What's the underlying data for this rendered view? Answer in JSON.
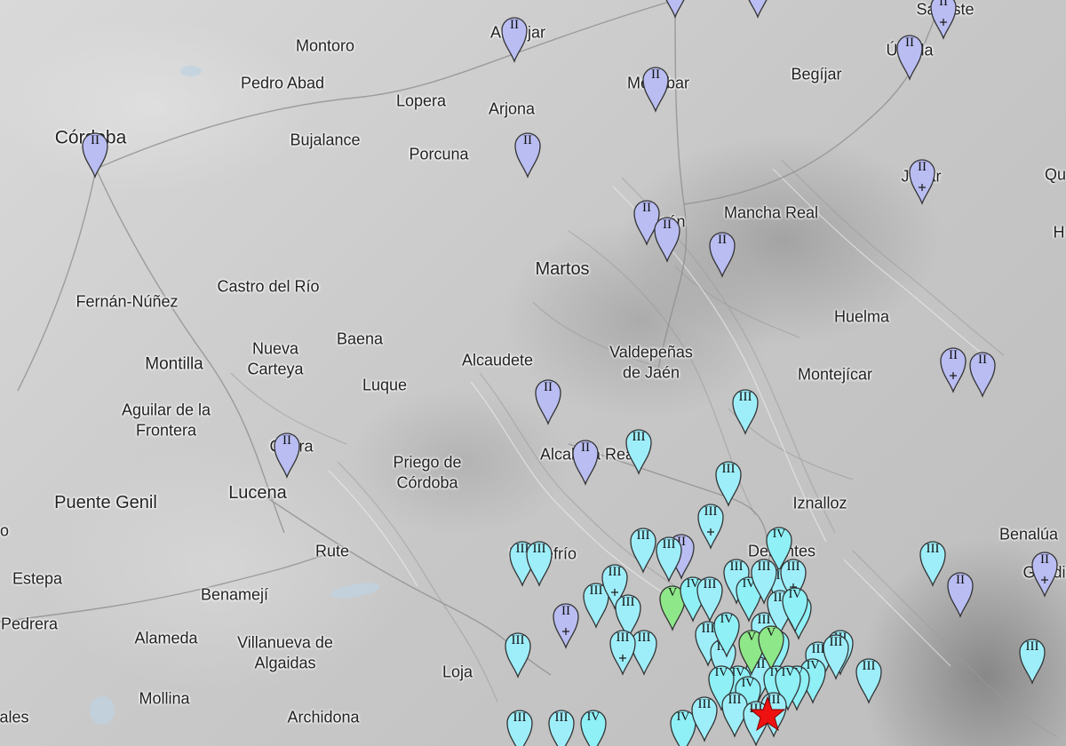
{
  "colors": {
    "intensity_II": "#b9bdf2",
    "intensity_III": "#9eeefa",
    "intensity_IV": "#8ff0f6",
    "intensity_V": "#8ee889",
    "epicenter": "#ee1111",
    "marker_stroke": "#333333",
    "label_text": "#222222"
  },
  "icons": {
    "marker": "map-pin-icon",
    "epicenter": "star-icon"
  },
  "places": [
    {
      "id": "cordoba",
      "name": "Córdoba"
    },
    {
      "id": "montoro",
      "name": "Montoro"
    },
    {
      "id": "pedro-abad",
      "name": "Pedro Abad"
    },
    {
      "id": "bujalance",
      "name": "Bujalance"
    },
    {
      "id": "lopera",
      "name": "Lopera"
    },
    {
      "id": "arjona",
      "name": "Arjona"
    },
    {
      "id": "porcuna",
      "name": "Porcuna"
    },
    {
      "id": "andujar",
      "name": "Andújar"
    },
    {
      "id": "mengibar",
      "name": "Menjíbar"
    },
    {
      "id": "begijar",
      "name": "Begíjar"
    },
    {
      "id": "ubeda",
      "name": "Úbeda"
    },
    {
      "id": "santiste",
      "name": "Santiste"
    },
    {
      "id": "jodar",
      "name": "Jódar"
    },
    {
      "id": "qu",
      "name": "Qu"
    },
    {
      "id": "h",
      "name": "H"
    },
    {
      "id": "jaen",
      "name": "Jaén"
    },
    {
      "id": "mancha-real",
      "name": "Mancha Real"
    },
    {
      "id": "martos",
      "name": "Martos"
    },
    {
      "id": "fernan-nunez",
      "name": "Fernán-Núñez"
    },
    {
      "id": "castro-del-rio",
      "name": "Castro del Río"
    },
    {
      "id": "huelma",
      "name": "Huelma"
    },
    {
      "id": "montilla",
      "name": "Montilla"
    },
    {
      "id": "nueva-carteya",
      "name": "Nueva\nCarteya"
    },
    {
      "id": "baena",
      "name": "Baena"
    },
    {
      "id": "alcaudete",
      "name": "Alcaudete"
    },
    {
      "id": "valdepenas",
      "name": "Valdepeñas\nde Jaén"
    },
    {
      "id": "montejicar",
      "name": "Montejícar"
    },
    {
      "id": "luque",
      "name": "Luque"
    },
    {
      "id": "aguilar",
      "name": "Aguilar de la\nFrontera"
    },
    {
      "id": "cabra",
      "name": "Cabra"
    },
    {
      "id": "priego",
      "name": "Priego de\nCórdoba"
    },
    {
      "id": "alcala-real",
      "name": "Alcalá la Real"
    },
    {
      "id": "lucena",
      "name": "Lucena"
    },
    {
      "id": "puente-genil",
      "name": "Puente Genil"
    },
    {
      "id": "iznalloz",
      "name": "Iznalloz"
    },
    {
      "id": "benalua",
      "name": "Benalúa"
    },
    {
      "id": "guadix",
      "name": "Guadix"
    },
    {
      "id": "o",
      "name": "o"
    },
    {
      "id": "rute",
      "name": "Rute"
    },
    {
      "id": "montefrio",
      "name": "Montefrío"
    },
    {
      "id": "deifontes",
      "name": "Deifontes"
    },
    {
      "id": "estepa",
      "name": "Estepa"
    },
    {
      "id": "benameji",
      "name": "Benamejí"
    },
    {
      "id": "pedrera",
      "name": "Pedrera"
    },
    {
      "id": "alameda",
      "name": "Alameda"
    },
    {
      "id": "villanueva",
      "name": "Villanueva de\nAlgaidas"
    },
    {
      "id": "loja",
      "name": "Loja"
    },
    {
      "id": "mollina",
      "name": "Mollina"
    },
    {
      "id": "archidona",
      "name": "Archidona"
    },
    {
      "id": "sales",
      "name": "ales"
    }
  ],
  "markers": [
    {
      "label": "II",
      "level": "II",
      "plus": false
    },
    {
      "label": "II",
      "level": "II",
      "plus": false
    },
    {
      "label": "II",
      "level": "II",
      "plus": false
    },
    {
      "label": "II",
      "level": "II",
      "plus": true
    },
    {
      "label": "II",
      "level": "II",
      "plus": false
    },
    {
      "label": "II",
      "level": "II",
      "plus": false
    },
    {
      "label": "II",
      "level": "II",
      "plus": false
    },
    {
      "label": "II",
      "level": "II",
      "plus": false
    },
    {
      "label": "II",
      "level": "II",
      "plus": false
    },
    {
      "label": "II",
      "level": "II",
      "plus": false
    },
    {
      "label": "II",
      "level": "II",
      "plus": true
    },
    {
      "label": "II",
      "level": "II",
      "plus": false
    },
    {
      "label": "II",
      "level": "II",
      "plus": true
    },
    {
      "label": "II",
      "level": "II",
      "plus": false
    },
    {
      "label": "II",
      "level": "II",
      "plus": false
    },
    {
      "label": "II",
      "level": "II",
      "plus": false
    },
    {
      "label": "III",
      "level": "III",
      "plus": false
    },
    {
      "label": "II",
      "level": "II",
      "plus": false
    },
    {
      "label": "III",
      "level": "III",
      "plus": false
    },
    {
      "label": "III",
      "level": "III",
      "plus": false
    },
    {
      "label": "III",
      "level": "III",
      "plus": true
    },
    {
      "label": "IV",
      "level": "IV",
      "plus": false
    },
    {
      "label": "III",
      "level": "III",
      "plus": false
    },
    {
      "label": "II",
      "level": "II",
      "plus": false
    },
    {
      "label": "II",
      "level": "II",
      "plus": true
    },
    {
      "label": "III",
      "level": "III",
      "plus": false
    },
    {
      "label": "III",
      "level": "III",
      "plus": false
    },
    {
      "label": "III",
      "level": "III",
      "plus": false
    },
    {
      "label": "III",
      "level": "III",
      "plus": false
    },
    {
      "label": "III",
      "level": "III",
      "plus": false
    },
    {
      "label": "II",
      "level": "II",
      "plus": false
    },
    {
      "label": "III",
      "level": "III",
      "plus": false
    },
    {
      "label": "III",
      "level": "III",
      "plus": false
    },
    {
      "label": "III",
      "level": "III",
      "plus": true
    },
    {
      "label": "II",
      "level": "II",
      "plus": true
    },
    {
      "label": "III",
      "level": "III",
      "plus": false
    },
    {
      "label": "III",
      "level": "III",
      "plus": false
    },
    {
      "label": "III",
      "level": "III",
      "plus": true
    },
    {
      "label": "V",
      "level": "V",
      "plus": false
    },
    {
      "label": "IV",
      "level": "IV",
      "plus": false
    },
    {
      "label": "III",
      "level": "III",
      "plus": false
    },
    {
      "label": "III",
      "level": "III",
      "plus": false
    },
    {
      "label": "III",
      "level": "III",
      "plus": false
    },
    {
      "label": "III",
      "level": "III",
      "plus": false
    },
    {
      "label": "IV",
      "level": "IV",
      "plus": false
    },
    {
      "label": "IV",
      "level": "IV",
      "plus": false
    },
    {
      "label": "III",
      "level": "III",
      "plus": false
    },
    {
      "label": "III",
      "level": "III",
      "plus": true
    },
    {
      "label": "III",
      "level": "III",
      "plus": false
    },
    {
      "label": "III",
      "level": "III",
      "plus": true
    },
    {
      "label": "III",
      "level": "III",
      "plus": false
    },
    {
      "label": "IV",
      "level": "IV",
      "plus": false
    },
    {
      "label": "III",
      "level": "III",
      "plus": false
    },
    {
      "label": "III",
      "level": "III",
      "plus": false
    },
    {
      "label": "IV",
      "level": "IV",
      "plus": false
    },
    {
      "label": "III",
      "level": "III",
      "plus": false
    },
    {
      "label": "IV",
      "level": "IV",
      "plus": false
    },
    {
      "label": "IV",
      "level": "IV",
      "plus": false
    },
    {
      "label": "III",
      "level": "III",
      "plus": false
    },
    {
      "label": "IV",
      "level": "IV",
      "plus": false
    },
    {
      "label": "IV",
      "level": "IV",
      "plus": false
    },
    {
      "label": "V",
      "level": "V",
      "plus": false
    },
    {
      "label": "V",
      "level": "V",
      "plus": false
    },
    {
      "label": "IV",
      "level": "IV",
      "plus": false
    },
    {
      "label": "IV",
      "level": "IV",
      "plus": false
    },
    {
      "label": "IV",
      "level": "IV",
      "plus": false
    },
    {
      "label": "IV",
      "level": "IV",
      "plus": false
    },
    {
      "label": "III",
      "level": "III",
      "plus": false
    },
    {
      "label": "IV",
      "level": "IV",
      "plus": false
    },
    {
      "label": "III",
      "level": "III",
      "plus": false
    },
    {
      "label": "III",
      "level": "III",
      "plus": false
    },
    {
      "label": "IV",
      "level": "IV",
      "plus": false
    },
    {
      "label": "III",
      "level": "III",
      "plus": false
    },
    {
      "label": "IV",
      "level": "IV",
      "plus": false
    },
    {
      "label": "III",
      "level": "III",
      "plus": false
    },
    {
      "label": "III",
      "level": "III",
      "plus": false
    },
    {
      "label": "III",
      "level": "III",
      "plus": false
    }
  ]
}
